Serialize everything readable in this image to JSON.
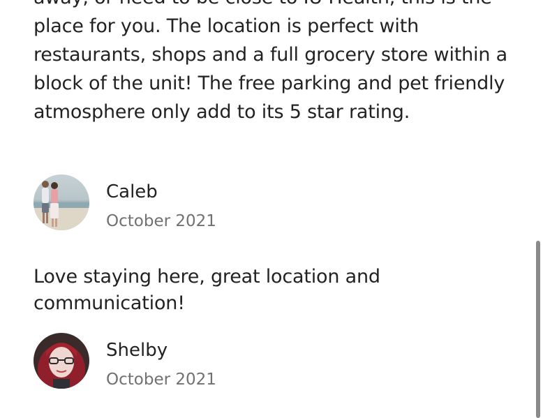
{
  "reviews": {
    "previous_text": "away, or need to be close to IU Health, this is the place for you. The location is perfect with restaurants, shops and a full grocery store within a block of the unit! The free parking and pet friendly atmosphere only add to its 5 star rating.",
    "items": [
      {
        "name": "Caleb",
        "date": "October 2021",
        "text": "Love staying here, great location and communication!"
      },
      {
        "name": "Shelby",
        "date": "October 2021",
        "text": ""
      }
    ]
  },
  "colors": {
    "primary_text": "#222222",
    "secondary_text": "#717171",
    "scrollbar": "#8a8a8a"
  }
}
